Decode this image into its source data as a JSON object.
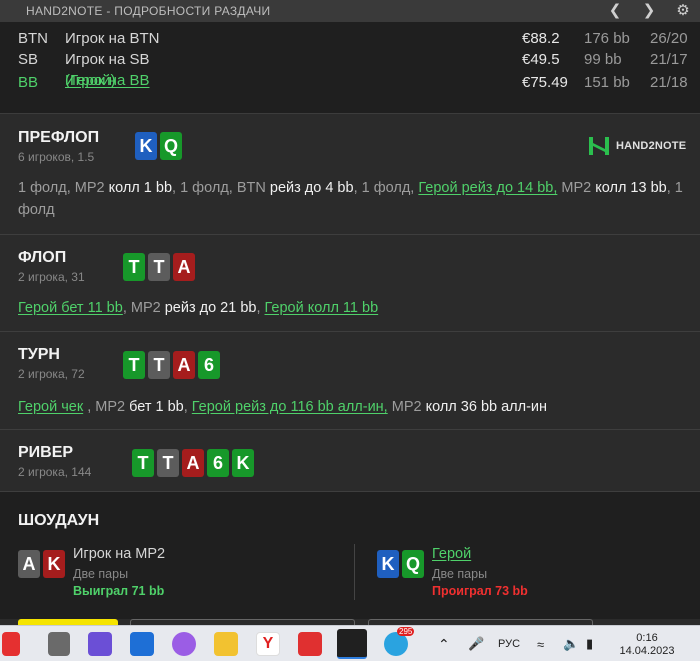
{
  "window": {
    "title": "HAND2NOTE - ПОДРОБНОСТИ РАЗДАЧИ",
    "icons": [
      "chevron-left-icon",
      "chevron-right-icon",
      "gear-icon"
    ]
  },
  "players": [
    {
      "pos": "BTN",
      "name": "Игрок на BTN",
      "money": "€88.2",
      "bb": "176 bb",
      "ratio": "26/20",
      "hero": false
    },
    {
      "pos": "SB",
      "name": "Игрок на SB",
      "money": "€49.5",
      "bb": "99 bb",
      "ratio": "21/17",
      "hero": false
    },
    {
      "pos": "BB",
      "name": "Игрок на BB",
      "hero_suffix": " (Герой)",
      "money": "€75.49",
      "bb": "151 bb",
      "ratio": "21/18",
      "hero": true
    }
  ],
  "logo_text": "HAND2NOTE",
  "streets": {
    "preflop": {
      "title": "ПРЕФЛОП",
      "sub": "6 игроков, 1.5",
      "cards": [
        {
          "r": "K",
          "c": "#1f5fbf"
        },
        {
          "r": "Q",
          "c": "#17982a"
        }
      ],
      "actions": [
        {
          "t": "1 фолд, МР2 ",
          "s": "m"
        },
        {
          "t": "колл 1 bb",
          "s": "w"
        },
        {
          "t": ", 1 фолд, BTN ",
          "s": "m"
        },
        {
          "t": "рейз до 4 bb",
          "s": "w"
        },
        {
          "t": ", 1 фолд, ",
          "s": "m"
        },
        {
          "t": "Герой рейз до 14 bb,",
          "s": "h"
        },
        {
          "t": " МР2 ",
          "s": "m"
        },
        {
          "t": "колл 13 bb",
          "s": "w"
        },
        {
          "t": ", 1 фолд",
          "s": "m"
        }
      ]
    },
    "flop": {
      "title": "ФЛОП",
      "sub": "2 игрока, 31",
      "cards": [
        {
          "r": "T",
          "c": "#17982a"
        },
        {
          "r": "T",
          "c": "#5c5c5c"
        },
        {
          "r": "A",
          "c": "#a51d1d"
        }
      ],
      "actions": [
        {
          "t": "Герой бет 11 bb",
          "s": "h"
        },
        {
          "t": ", МР2 ",
          "s": "m"
        },
        {
          "t": "рейз до 21 bb",
          "s": "w"
        },
        {
          "t": ", ",
          "s": "m"
        },
        {
          "t": "Герой колл 11 bb",
          "s": "h"
        }
      ]
    },
    "turn": {
      "title": "ТУРН",
      "sub": "2 игрока, 72",
      "cards": [
        {
          "r": "T",
          "c": "#17982a"
        },
        {
          "r": "T",
          "c": "#5c5c5c"
        },
        {
          "r": "A",
          "c": "#a51d1d"
        },
        {
          "r": "6",
          "c": "#17982a"
        }
      ],
      "actions": [
        {
          "t": "Герой чек",
          "s": "h"
        },
        {
          "t": " , МР2 ",
          "s": "m"
        },
        {
          "t": "бет 1 bb",
          "s": "w"
        },
        {
          "t": ", ",
          "s": "m"
        },
        {
          "t": "Герой рейз до 116 bb алл-ин,",
          "s": "h"
        },
        {
          "t": " МР2 ",
          "s": "m"
        },
        {
          "t": "колл 36 bb алл-ин",
          "s": "w"
        }
      ]
    },
    "river": {
      "title": "РИВЕР",
      "sub": "2 игрока, 144",
      "cards": [
        {
          "r": "T",
          "c": "#17982a"
        },
        {
          "r": "T",
          "c": "#5c5c5c"
        },
        {
          "r": "A",
          "c": "#a51d1d"
        },
        {
          "r": "6",
          "c": "#17982a"
        },
        {
          "r": "K",
          "c": "#17982a"
        }
      ]
    }
  },
  "showdown": {
    "title": "ШОУДАУН",
    "villain": {
      "cards": [
        {
          "r": "A",
          "c": "#5c5c5c"
        },
        {
          "r": "K",
          "c": "#a51d1d"
        }
      ],
      "name": "Игрок на МР2",
      "hand": "Две пары",
      "result": "Выиграл 71 bb",
      "result_color": "#4fd16a"
    },
    "hero": {
      "cards": [
        {
          "r": "K",
          "c": "#1f5fbf"
        },
        {
          "r": "Q",
          "c": "#17982a"
        }
      ],
      "name": "Герой",
      "hand": "Две пары",
      "result": "Проиграл 73 bb",
      "result_color": "#f03030"
    }
  },
  "taskbar": {
    "tray_badge": "295",
    "lang": "РУС",
    "time": "0:16",
    "date": "14.04.2023"
  }
}
